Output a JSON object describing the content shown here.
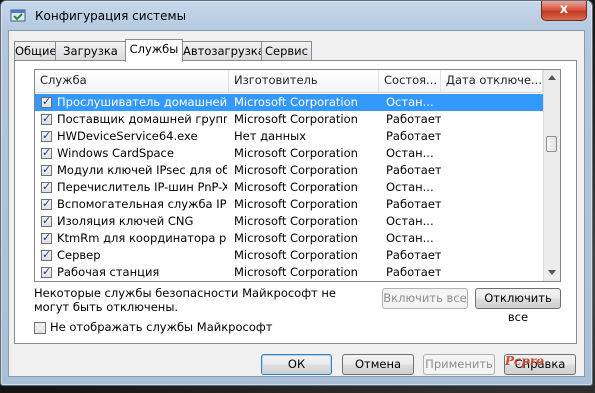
{
  "window": {
    "title": "Конфигурация системы",
    "close_glyph": "x",
    "app_icon": "msconfig-icon"
  },
  "tabs": [
    {
      "label": "Общие",
      "active": false
    },
    {
      "label": "Загрузка",
      "active": false
    },
    {
      "label": "Службы",
      "active": true
    },
    {
      "label": "Автозагрузка",
      "active": false
    },
    {
      "label": "Сервис",
      "active": false
    }
  ],
  "services": {
    "columns": [
      "Служба",
      "Изготовитель",
      "Состоя...",
      "Дата отключе..."
    ],
    "rows": [
      {
        "checked": true,
        "name": "Прослушиватель домашней гр...",
        "maker": "Microsoft Corporation",
        "status": "Остан...",
        "date": "",
        "selected": true
      },
      {
        "checked": true,
        "name": "Поставщик домашней группы",
        "maker": "Microsoft Corporation",
        "status": "Работает",
        "date": ""
      },
      {
        "checked": true,
        "name": "HWDeviceService64.exe",
        "maker": "Нет данных",
        "status": "Работает",
        "date": ""
      },
      {
        "checked": true,
        "name": "Windows CardSpace",
        "maker": "Microsoft Corporation",
        "status": "Остан...",
        "date": ""
      },
      {
        "checked": true,
        "name": "Модули ключей IPsec для обм...",
        "maker": "Microsoft Corporation",
        "status": "Работает",
        "date": ""
      },
      {
        "checked": true,
        "name": "Перечислитель IP-шин PnP-X",
        "maker": "Microsoft Corporation",
        "status": "Остан...",
        "date": ""
      },
      {
        "checked": true,
        "name": "Вспомогательная служба IP",
        "maker": "Microsoft Corporation",
        "status": "Работает",
        "date": ""
      },
      {
        "checked": true,
        "name": "Изоляция ключей CNG",
        "maker": "Microsoft Corporation",
        "status": "Остан...",
        "date": ""
      },
      {
        "checked": true,
        "name": "KtmRm для координатора рас...",
        "maker": "Microsoft Corporation",
        "status": "Остан...",
        "date": ""
      },
      {
        "checked": true,
        "name": "Сервер",
        "maker": "Microsoft Corporation",
        "status": "Работает",
        "date": ""
      },
      {
        "checked": true,
        "name": "Рабочая станция",
        "maker": "Microsoft Corporation",
        "status": "Работает",
        "date": ""
      }
    ]
  },
  "note": "Некоторые службы безопасности Майкрософт не могут быть отключены.",
  "buttons": {
    "enable_all": "Включить все",
    "disable_all": "Отключить все",
    "ok": "ОК",
    "cancel": "Отмена",
    "apply": "Применить",
    "help": "Справка"
  },
  "hide_ms_checkbox": {
    "label": "Не отображать службы Майкрософт",
    "checked": false
  },
  "watermark": "Pcpro",
  "colors": {
    "selection": "#3399ff",
    "close_button": "#c8402a"
  }
}
